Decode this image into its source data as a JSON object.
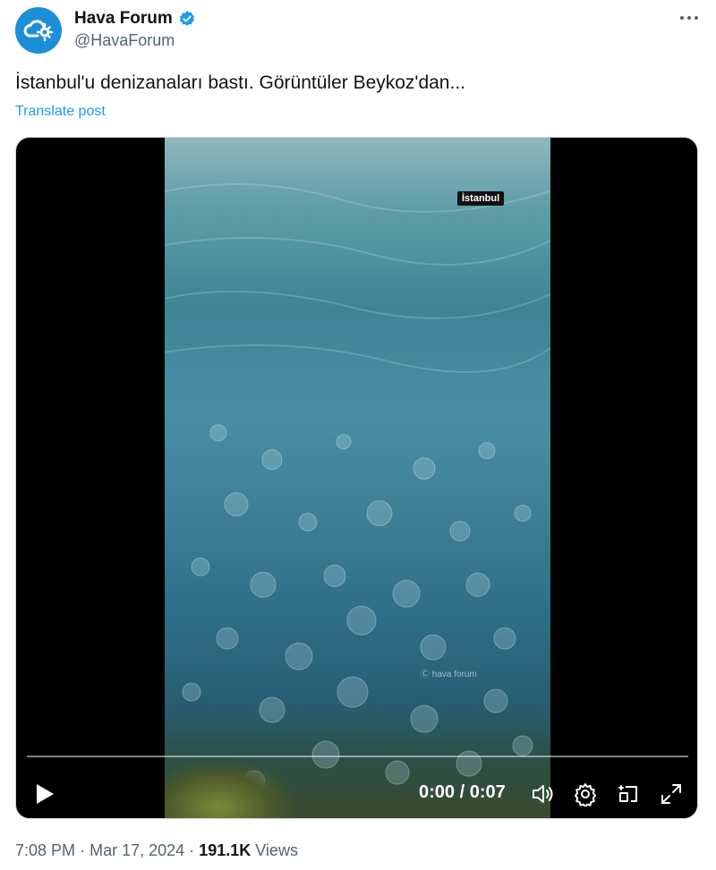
{
  "author": {
    "display_name": "Hava Forum",
    "handle": "@HavaForum",
    "verified": true,
    "avatar_icon": "cloud-sun-icon",
    "avatar_color": "#1d8fd8"
  },
  "post": {
    "text": "İstanbul'u denizanaları bastı. Görüntüler Beykoz'dan...",
    "translate_label": "Translate post"
  },
  "video": {
    "overlay_tag": "İstanbul",
    "watermark": "Ⓒ hava forum",
    "time_display": "0:00 / 0:07",
    "progress": 0,
    "controls": [
      "play-icon",
      "volume-icon",
      "settings-icon",
      "pip-icon",
      "fullscreen-icon"
    ]
  },
  "meta": {
    "time": "7:08 PM",
    "date": "Mar 17, 2024",
    "views_count": "191.1K",
    "views_label": "Views"
  },
  "colors": {
    "link": "#1d9bf0",
    "secondary_text": "#536471",
    "verified_badge": "#1d9bf0"
  }
}
